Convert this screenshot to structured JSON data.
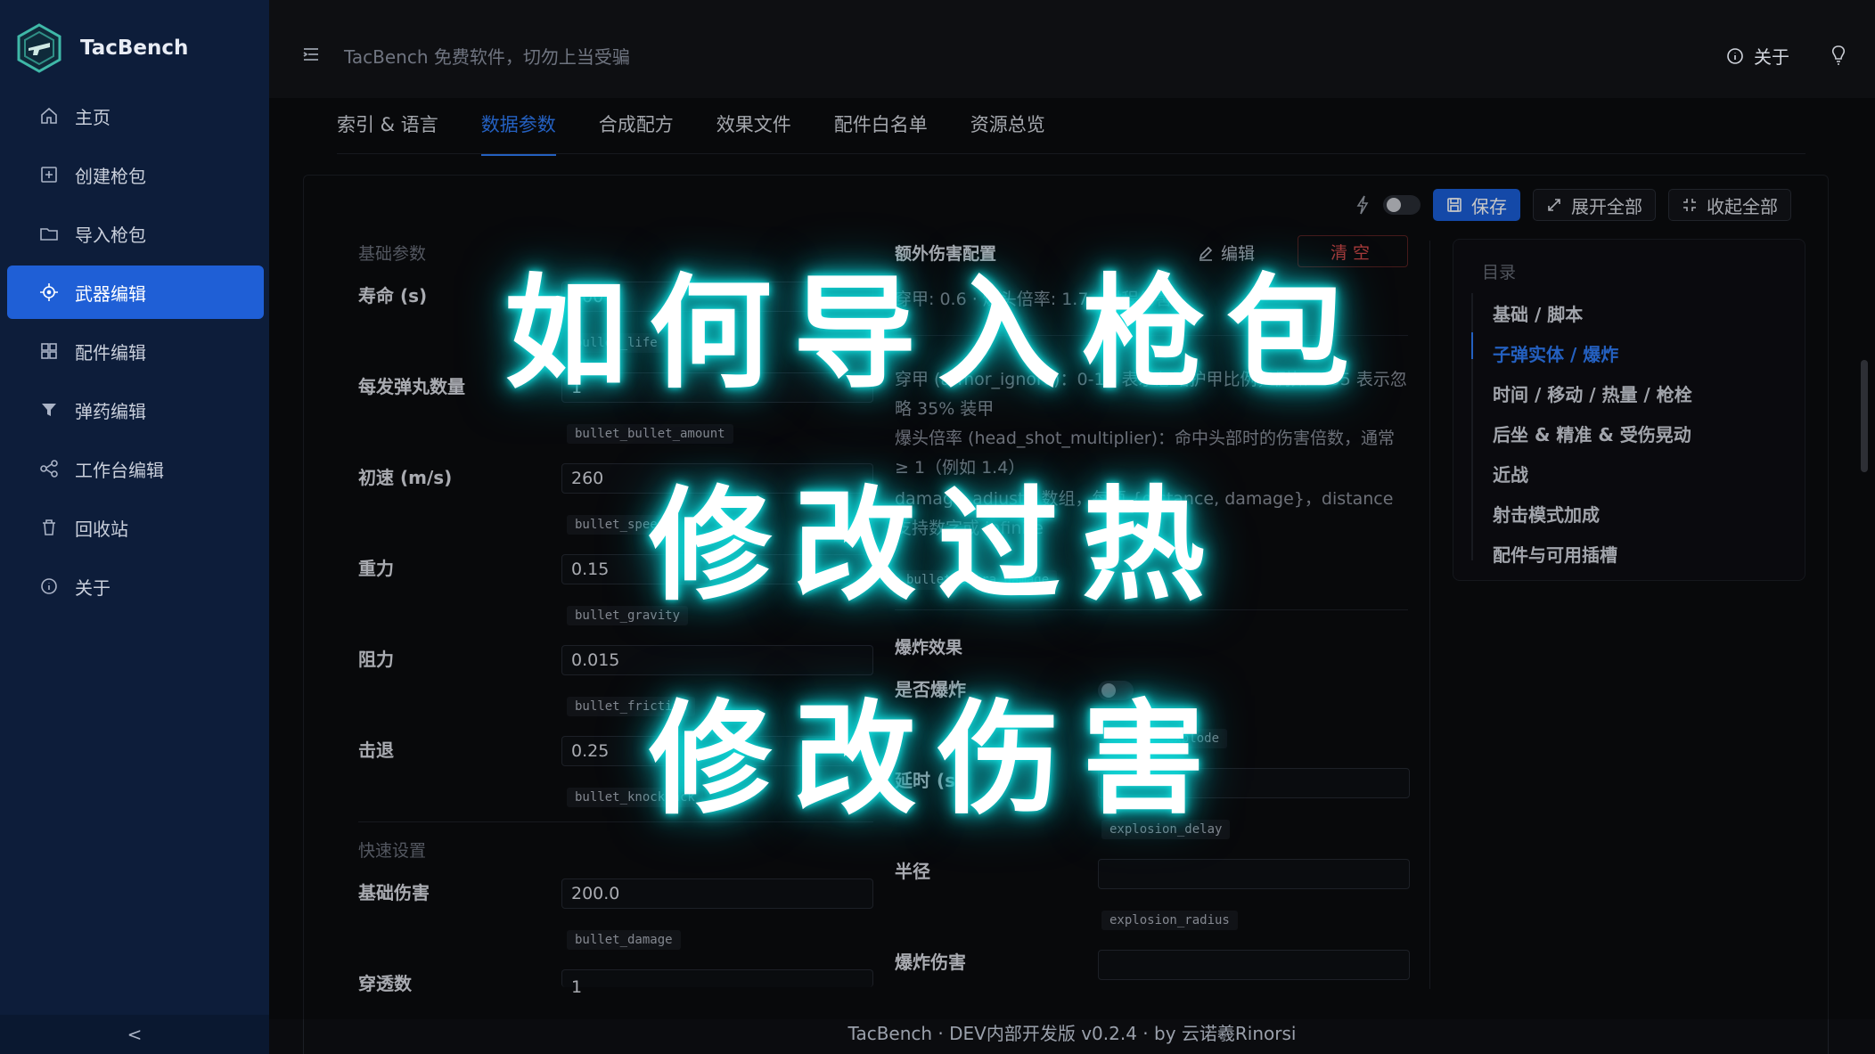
{
  "app": {
    "name": "TacBench"
  },
  "header": {
    "title": "TacBench 免费软件，切勿上当受骗",
    "about_label": "关于"
  },
  "sidebar": {
    "items": [
      {
        "label": "主页",
        "icon": "home-icon"
      },
      {
        "label": "创建枪包",
        "icon": "plus-square-icon"
      },
      {
        "label": "导入枪包",
        "icon": "folder-icon"
      },
      {
        "label": "武器编辑",
        "icon": "crosshair-icon",
        "active": true
      },
      {
        "label": "配件编辑",
        "icon": "grid-icon"
      },
      {
        "label": "弹药编辑",
        "icon": "filter-icon"
      },
      {
        "label": "工作台编辑",
        "icon": "share-icon"
      },
      {
        "label": "回收站",
        "icon": "trash-icon"
      },
      {
        "label": "关于",
        "icon": "info-icon"
      }
    ],
    "collapse_label": "<"
  },
  "tabs": [
    {
      "label": "索引 & 语言"
    },
    {
      "label": "数据参数",
      "active": true
    },
    {
      "label": "合成配方"
    },
    {
      "label": "效果文件"
    },
    {
      "label": "配件白名单"
    },
    {
      "label": "资源总览"
    }
  ],
  "toolbar": {
    "save_label": "保存",
    "expand_label": "展开全部",
    "collapse_label": "收起全部"
  },
  "form": {
    "basic_section": "基础参数",
    "quick_section": "快速设置",
    "fields": [
      {
        "label": "寿命 (s)",
        "value": "100",
        "key": "bullet_life"
      },
      {
        "label": "每发弹丸数量",
        "value": "1",
        "key": "bullet_bullet_amount"
      },
      {
        "label": "初速 (m/s)",
        "value": "260",
        "key": "bullet_speed"
      },
      {
        "label": "重力",
        "value": "0.15",
        "key": "bullet_gravity"
      },
      {
        "label": "阻力",
        "value": "0.015",
        "key": "bullet_friction"
      },
      {
        "label": "击退",
        "value": "0.25",
        "key": "bullet_knockback"
      }
    ],
    "quick_fields": [
      {
        "label": "基础伤害",
        "value": "200.0",
        "key": "bullet_damage"
      },
      {
        "label": "穿透数",
        "value": "1",
        "key": ""
      }
    ]
  },
  "extra_damage": {
    "title": "额外伤害配置",
    "edit_label": "编辑",
    "clear_label": "清空",
    "summary": "穿甲: 0.6 · 爆头倍率: 1.7 · 射程伤害",
    "desc_armor": "穿甲 (armor_ignore)：0-1，表示忽略护甲比例，例如 0.35 表示忽略 35% 装甲",
    "desc_headshot": "爆头倍率 (head_shot_multiplier)：命中头部时的伤害倍数，通常 ≥ 1（例如 1.4）",
    "desc_adjust": "damage_adjust：数组，每项 {distance, damage}，distance 支持数字或 infinite",
    "key": "bullet.extra_damage"
  },
  "explosion": {
    "title": "爆炸效果",
    "enable_label": "是否爆炸",
    "enable_key": "explode",
    "delay_label": "延时 (s)",
    "delay_key": "explosion_delay",
    "radius_label": "半径",
    "radius_key": "explosion_radius",
    "damage_label": "爆炸伤害"
  },
  "toc": {
    "title": "目录",
    "items": [
      {
        "label": "基础 / 脚本"
      },
      {
        "label": "子弹实体 / 爆炸",
        "active": true
      },
      {
        "label": "时间 / 移动 / 热量 / 枪栓"
      },
      {
        "label": "后坐 & 精准 & 受伤晃动"
      },
      {
        "label": "近战"
      },
      {
        "label": "射击模式加成"
      },
      {
        "label": "配件与可用插槽"
      }
    ]
  },
  "footer": {
    "text": "TacBench · DEV内部开发版 v0.2.4 · by 云诺羲Rinorsi"
  },
  "overlay": {
    "line1": "如何导入枪包",
    "line2": "修改过热",
    "line3": "修改伤害"
  },
  "colors": {
    "accent": "#2f7cf6",
    "sidebar_bg": "#0d1d3a",
    "active_nav": "#1f5fd6",
    "danger": "#d84a4a",
    "glow": "#12e0e0"
  }
}
